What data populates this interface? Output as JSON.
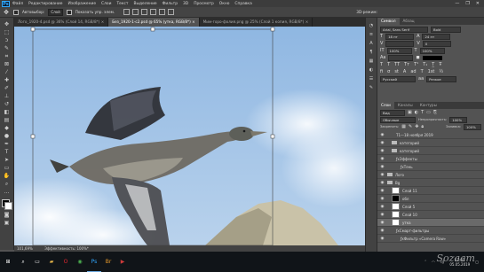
{
  "app": {
    "logo": "Ps"
  },
  "menu": [
    "Файл",
    "Редактирование",
    "Изображение",
    "Слои",
    "Текст",
    "Выделение",
    "Фильтр",
    "3D",
    "Просмотр",
    "Окно",
    "Справка"
  ],
  "window_controls": [
    "—",
    "❐",
    "✕"
  ],
  "options_bar": {
    "auto_select_label": "Автовыбор:",
    "auto_select_value": "Слой",
    "transform_controls_label": "Показать упр. элем.",
    "threed_label": "3D-режим:"
  },
  "tabs": [
    {
      "label": "Лого_1920-4.psd @ 36% (Слой 14, RGB/8*) ×",
      "active": false
    },
    {
      "label": "Без_1920-1-с2.psd @ 65% (утка, RGB/8*) ×",
      "active": true
    },
    {
      "label": "Мим-горо-фолия.png @ 25% (Слой 1 копия, RGB/8*) ×",
      "active": false
    }
  ],
  "status_bar": {
    "zoom": "101,69%",
    "doc": "Эффективность: 100%*"
  },
  "panels": {
    "character": {
      "tabs": [
        "Символ",
        "Абзац"
      ],
      "font": "Arial, Sans Serif",
      "style": "Bold",
      "size": "18 пт",
      "leading": "24 пт",
      "tracking": "0",
      "scale_v": "100%",
      "scale_h": "100%",
      "lang": "Русский",
      "aa": "Резкое"
    },
    "layers": {
      "tabs": [
        "Слои",
        "Каналы",
        "Контуры"
      ],
      "filter_label": "Вид",
      "blend": "Обычные",
      "opacity_label": "Непрозрачность:",
      "opacity": "100%",
      "lock_label": "Закрепить:",
      "fill_label": "Заливка:",
      "fill": "100%",
      "rows": [
        {
          "name": "1—18 ноября 2019",
          "type": "text",
          "selected": false,
          "indent": 2
        },
        {
          "name": "категорий",
          "type": "folder",
          "selected": false,
          "indent": 1
        },
        {
          "name": "категорий",
          "type": "folder",
          "selected": false,
          "indent": 1
        },
        {
          "name": "Эффекты",
          "type": "fx",
          "selected": false,
          "indent": 2
        },
        {
          "name": "Тень",
          "type": "fx",
          "selected": false,
          "indent": 3
        },
        {
          "name": "Лого",
          "type": "folder",
          "selected": false,
          "indent": 0
        },
        {
          "name": "Bg",
          "type": "folder",
          "selected": false,
          "indent": 0
        },
        {
          "name": "Слой 11",
          "type": "layer",
          "selected": false,
          "indent": 1
        },
        {
          "name": "обл",
          "type": "mask",
          "selected": false,
          "indent": 1
        },
        {
          "name": "Слой 5",
          "type": "layer",
          "selected": false,
          "indent": 1
        },
        {
          "name": "Слой 10",
          "type": "layer",
          "selected": false,
          "indent": 1
        },
        {
          "name": "утка",
          "type": "layer",
          "selected": true,
          "indent": 1
        },
        {
          "name": "Смарт-фильтры",
          "type": "fx",
          "selected": false,
          "indent": 2
        },
        {
          "name": "Фильтр «Camera Raw»",
          "type": "fx",
          "selected": false,
          "indent": 3
        }
      ]
    }
  },
  "taskbar": {
    "time": "17:47",
    "date": "05.05.2019",
    "icons": [
      "start",
      "search",
      "task-view",
      "explorer",
      "opera",
      "chrome",
      "photoshop",
      "adobe-bridge",
      "media"
    ]
  },
  "watermark": "Sozaam"
}
